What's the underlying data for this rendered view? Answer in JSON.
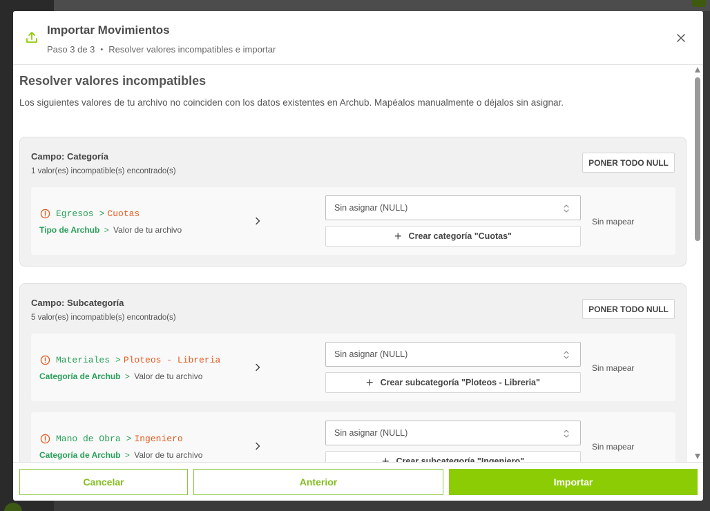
{
  "modal": {
    "title": "Importar Movimientos",
    "step": "Paso 3 de 3",
    "step_separator": "•",
    "step_desc": "Resolver valores incompatibles e importar"
  },
  "section": {
    "title": "Resolver valores incompatibles",
    "description": "Los siguientes valores de tu archivo no coinciden con los datos existentes en Archub. Mapéalos manualmente o déjalos sin asignar."
  },
  "fields": [
    {
      "name": "Campo: Categoría",
      "count": "1 valor(es) incompatible(s) encontrado(s)",
      "null_button": "PONER TODO NULL",
      "rows": [
        {
          "type": "Egresos",
          "separator": ">",
          "value": "Cuotas",
          "legend_type": "Tipo de Archub",
          "legend_separator": ">",
          "legend_value": "Valor de tu archivo",
          "select_value": "Sin asignar (NULL)",
          "create_label": "Crear categoría \"Cuotas\"",
          "status": "Sin mapear"
        }
      ]
    },
    {
      "name": "Campo: Subcategoría",
      "count": "5 valor(es) incompatible(s) encontrado(s)",
      "null_button": "PONER TODO NULL",
      "rows": [
        {
          "type": "Materiales",
          "separator": ">",
          "value": "Ploteos - Libreria",
          "legend_type": "Categoría de Archub",
          "legend_separator": ">",
          "legend_value": "Valor de tu archivo",
          "select_value": "Sin asignar (NULL)",
          "create_label": "Crear subcategoría \"Ploteos - Libreria\"",
          "status": "Sin mapear"
        },
        {
          "type": "Mano de Obra",
          "separator": ">",
          "value": "Ingeniero",
          "legend_type": "Categoría de Archub",
          "legend_separator": ">",
          "legend_value": "Valor de tu archivo",
          "select_value": "Sin asignar (NULL)",
          "create_label": "Crear subcategoría \"Ingeniero\"",
          "status": "Sin mapear"
        }
      ]
    }
  ],
  "footer": {
    "cancel_label": "Cancelar",
    "previous_label": "Anterior",
    "import_label": "Importar"
  },
  "colors": {
    "accent": "#8ccc05",
    "type_green": "#2aa05b",
    "value_orange": "#e8581e"
  },
  "icons": {
    "header": "upload-icon",
    "close": "close-icon",
    "warning": "warning-circle-icon",
    "arrow": "chevron-right-icon",
    "select": "updown-icon",
    "create": "plus-icon"
  }
}
